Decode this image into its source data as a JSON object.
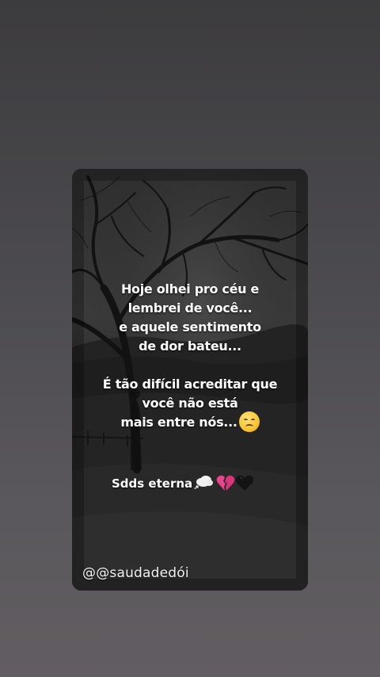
{
  "story": {
    "quote_lines": [
      "Hoje olhei pro céu e",
      "lembrei de você...",
      "e aquele sentimento",
      "de dor bateu..."
    ],
    "quote_lines_2": [
      "É tão difícil acreditar que",
      "você não está",
      "mais entre nós..."
    ],
    "signature_text": "Sdds eterna",
    "handle": "@@saudadedói",
    "emojis": {
      "after_quote": "sad-face-icon",
      "signature": [
        "thought-cloud-icon",
        "broken-heart-icon",
        "black-heart-icon"
      ]
    }
  },
  "colors": {
    "background_top": "#3c3b3e",
    "background_bottom": "#625d62",
    "card_background": "#262626",
    "text": "#ffffff",
    "broken_heart": "#e8468a"
  }
}
